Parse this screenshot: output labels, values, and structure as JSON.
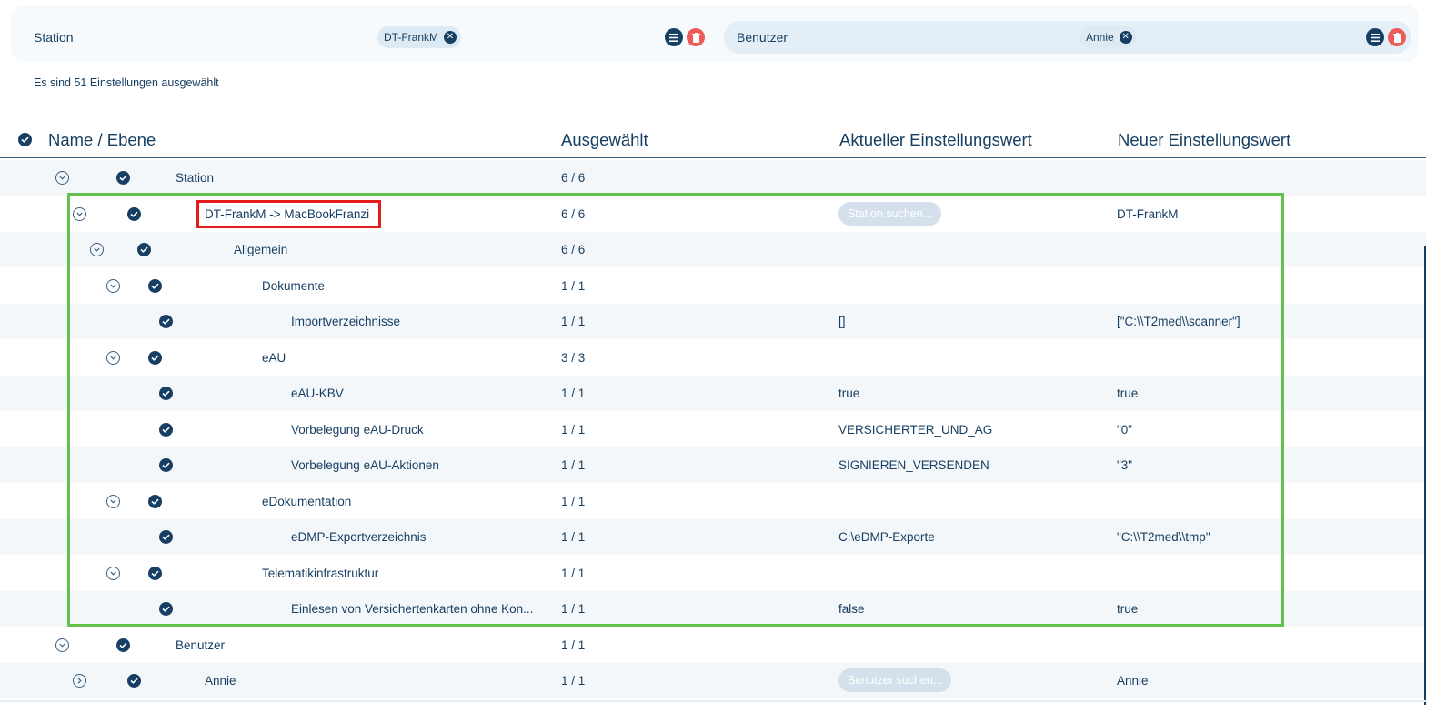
{
  "filters": {
    "station": {
      "label": "Station",
      "chip": "DT-FrankM"
    },
    "user": {
      "label": "Benutzer",
      "chip": "Annie"
    }
  },
  "summary": "Es sind 51 Einstellungen ausgewählt",
  "table": {
    "headers": {
      "name": "Name / Ebene",
      "selected": "Ausgewählt",
      "current": "Aktueller Einstellungswert",
      "new": "Neuer Einstellungswert"
    },
    "rows": [
      {
        "name": "Station",
        "selected": "6 / 6",
        "current": "",
        "new": ""
      },
      {
        "name": "DT-FrankM -> MacBookFranzi",
        "selected": "6 / 6",
        "current": "",
        "new": "DT-FrankM",
        "search_placeholder": "Station suchen..."
      },
      {
        "name": "Allgemein",
        "selected": "6 / 6",
        "current": "",
        "new": ""
      },
      {
        "name": "Dokumente",
        "selected": "1 / 1",
        "current": "",
        "new": ""
      },
      {
        "name": "Importverzeichnisse",
        "selected": "1 / 1",
        "current": "[]",
        "new": "[\"C:\\\\T2med\\\\scanner\"]"
      },
      {
        "name": "eAU",
        "selected": "3 / 3",
        "current": "",
        "new": ""
      },
      {
        "name": "eAU-KBV",
        "selected": "1 / 1",
        "current": "true",
        "new": "true"
      },
      {
        "name": "Vorbelegung eAU-Druck",
        "selected": "1 / 1",
        "current": "VERSICHERTER_UND_AG",
        "new": "\"0\""
      },
      {
        "name": "Vorbelegung eAU-Aktionen",
        "selected": "1 / 1",
        "current": "SIGNIEREN_VERSENDEN",
        "new": "\"3\""
      },
      {
        "name": "eDokumentation",
        "selected": "1 / 1",
        "current": "",
        "new": ""
      },
      {
        "name": "eDMP-Exportverzeichnis",
        "selected": "1 / 1",
        "current": "C:\\eDMP-Exporte",
        "new": "\"C:\\\\T2med\\\\tmp\""
      },
      {
        "name": "Telematikinfrastruktur",
        "selected": "1 / 1",
        "current": "",
        "new": ""
      },
      {
        "name": "Einlesen von Versichertenkarten ohne Kon...",
        "selected": "1 / 1",
        "current": "false",
        "new": "true"
      },
      {
        "name": "Benutzer",
        "selected": "1 / 1",
        "current": "",
        "new": ""
      },
      {
        "name": "Annie",
        "selected": "1 / 1",
        "current": "",
        "new": "Annie",
        "search_placeholder": "Benutzer suchen..."
      }
    ]
  },
  "colors": {
    "primary": "#173f63",
    "danger": "#ee5b5b",
    "highlight_red": "#e31b1b",
    "highlight_green": "#63c14c"
  }
}
